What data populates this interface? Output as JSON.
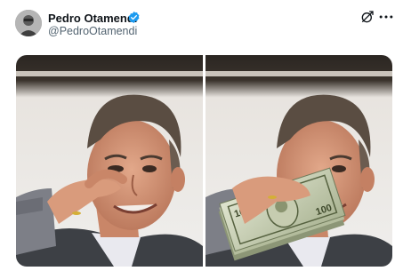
{
  "post": {
    "author_name": "Pedro Otamendi",
    "author_handle": "@PedroOtamendi",
    "verified": true,
    "avatar_icon": "profile-photo",
    "actions": {
      "grok_icon": "grok-icon",
      "more_icon": "more-options-icon"
    }
  },
  "media": {
    "photos": [
      {
        "description_icon": "man-with-hand-at-forehead-photo"
      },
      {
        "description_icon": "man-holding-cash-stack-photo"
      }
    ]
  },
  "colors": {
    "text_primary": "#0f1419",
    "text_secondary": "#536471",
    "verified_blue": "#1d9bf0",
    "background": "#ffffff"
  }
}
